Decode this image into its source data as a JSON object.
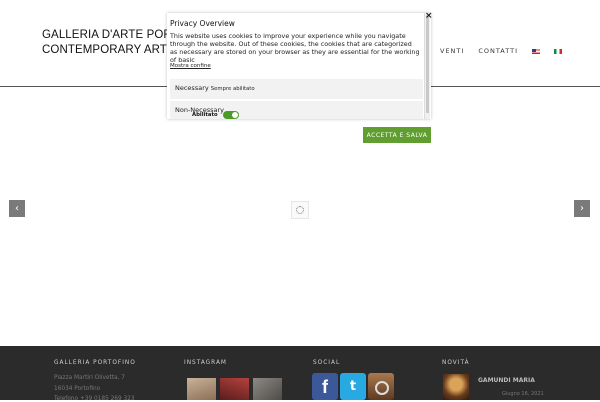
{
  "header": {
    "logo_line1": "GALLERIA D'ARTE PORTOFI",
    "logo_line2": "CONTEMPORARY ART",
    "nav_items": [
      "VENTI",
      "CONTATTI"
    ]
  },
  "cookie_popup": {
    "close_symbol": "×",
    "title": "Privacy Overview",
    "text": "This website uses cookies to improve your experience while you navigate through the website. Out of these cookies, the cookies that are categorized as necessary are stored on your browser as they are essential for the working of basic",
    "link_label": "Mostra confine",
    "necessary_label": "Necessary",
    "necessary_status": "Sempre abilitato",
    "non_necessary_label": "Non-Necessary",
    "toggle_label": "Abilitato",
    "accept_button": "ACCETTA E SALVA"
  },
  "slider": {
    "prev_symbol": "‹",
    "next_symbol": "›"
  },
  "footer": {
    "col1_title": "GALLERIA PORTOFINO",
    "address_line1": "Piazza Martiri Olivetta, 7",
    "address_line2": "16034 Portofino",
    "phone": "Telefono +39 0185 269 323",
    "col2_title": "INSTAGRAM",
    "col3_title": "SOCIAL",
    "facebook_glyph": "f",
    "twitter_glyph": "t",
    "col4_title": "NOVITÀ",
    "news_title": "GAMUNDI MARIA",
    "news_date": "Giugno 16, 2021"
  },
  "colors": {
    "accept_button": "#5f9e2f",
    "footer_bg": "#2b2b2b",
    "toggle_on": "#4c9a2a"
  }
}
